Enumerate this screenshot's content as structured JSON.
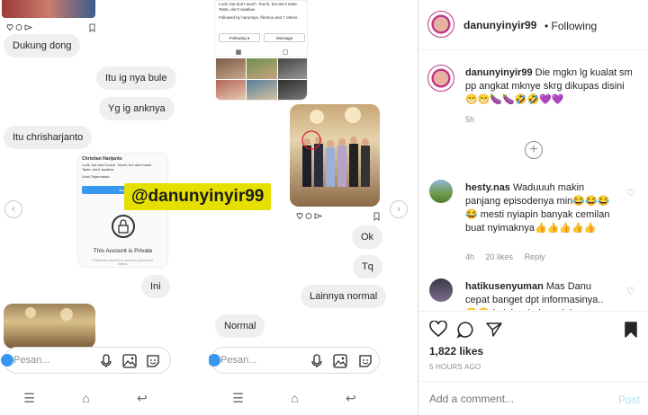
{
  "chat1": {
    "messages": {
      "m1": "Dukung dong",
      "m2": "Itu ig nya bule",
      "m3": "Yg ig anknya",
      "m4": "Itu chrisharjanto",
      "m5": "Ini"
    },
    "profile_card": {
      "name": "Christian Harijanto",
      "bio": "Look, but don't touch. Touch, but don't taste. Taste, don't swallow.",
      "translate": "Lihat Terjemahan",
      "follow_label": "Ikuti",
      "private_title": "This Account is Private",
      "private_sub": "Follow this account to see their photos and videos."
    },
    "input_placeholder": "Pesan..."
  },
  "chat2": {
    "profile_top": {
      "bio": "Look, but don't touch. Touch, but don't taste. Taste, don't swallow.",
      "followed_by": "Followed by harumips, ffernloo and 7 others",
      "following_label": "Following ▾",
      "message_label": "Message"
    },
    "messages": {
      "m1": "Ok",
      "m2": "Tq",
      "m3": "Lainnya normal",
      "m4": "Normal"
    },
    "input_placeholder": "Pesan..."
  },
  "watermark": "@danunyinyir99",
  "post": {
    "header_user": "danunyinyir99",
    "header_status": "• Following",
    "caption_user": "danunyinyir99",
    "caption_text": "Die mgkn lg kualat sm pp angkat mknye skrg dikupas disini 😁😁🍆🍆🤣🤣💜💜",
    "caption_time": "5h",
    "comments": [
      {
        "user": "hesty.nas",
        "text": "Waduuuh makin panjang episodenya min😂😂😂😂 mesti nyiapin banyak cemilan buat nyimaknya👍👍👍👍👍",
        "time": "4h",
        "likes": "20 likes",
        "reply": "Reply"
      },
      {
        "user": "hatikusenyuman",
        "text": "Mas Danu cepat banget dpt informasinya..😂😂 kalah admin yg lainnya",
        "time": "",
        "likes": "",
        "reply": ""
      }
    ],
    "likes": "1,822 likes",
    "timestamp": "5 HOURS AGO",
    "add_comment_placeholder": "Add a comment...",
    "post_label": "Post"
  }
}
